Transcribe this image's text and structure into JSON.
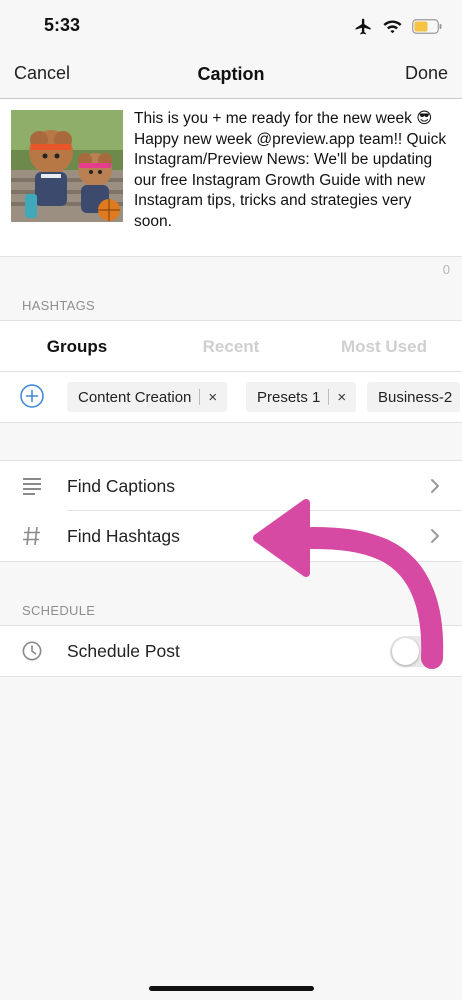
{
  "status_bar": {
    "time": "5:33",
    "icons": [
      "airplane-icon",
      "wifi-icon",
      "battery-icon"
    ],
    "battery_color": "#f5c242"
  },
  "nav": {
    "cancel_label": "Cancel",
    "title": "Caption",
    "done_label": "Done"
  },
  "caption": {
    "text": "This is you + me ready for the new week 😎 Happy new week @preview.app team!! Quick Instagram/Preview News: We'll be updating our free Instagram Growth Guide with new Instagram tips, tricks and strategies very soon.",
    "char_count": "0"
  },
  "hashtags": {
    "section_label": "HASHTAGS",
    "tabs": [
      {
        "label": "Groups",
        "active": true
      },
      {
        "label": "Recent",
        "active": false
      },
      {
        "label": "Most Used",
        "active": false
      }
    ],
    "add_icon": "plus-circle-icon",
    "chips": [
      {
        "label": "Content Creation",
        "remove": "×"
      },
      {
        "label": "Presets 1",
        "remove": "×"
      },
      {
        "label": "Business-2"
      }
    ]
  },
  "tools": {
    "items": [
      {
        "label": "Find Captions",
        "icon": "lines-icon"
      },
      {
        "label": "Find Hashtags",
        "icon": "hash-icon"
      }
    ]
  },
  "schedule": {
    "section_label": "SCHEDULE",
    "item_label": "Schedule Post",
    "icon": "clock-icon",
    "toggle_on": false
  },
  "annotation": {
    "arrow_color": "#d64aa3"
  }
}
